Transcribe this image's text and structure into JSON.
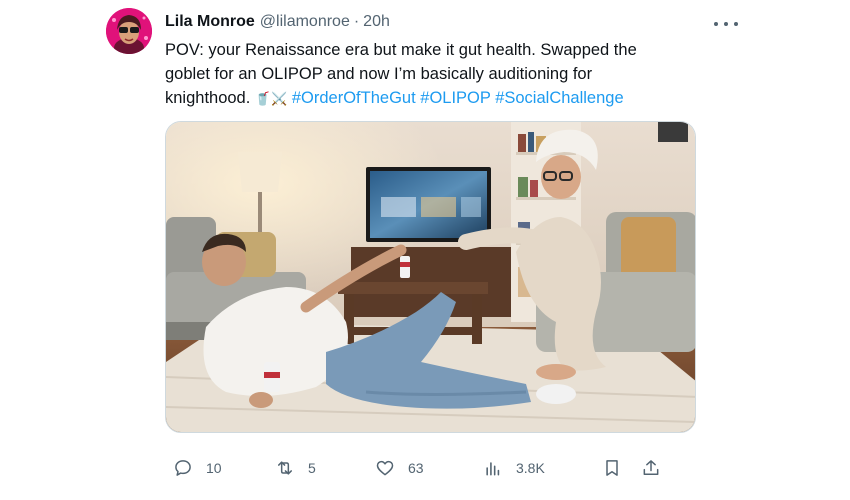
{
  "author": {
    "name": "Lila Monroe",
    "handle": "@lilamonroe",
    "separator": "·",
    "time": "20h"
  },
  "tweet": {
    "text_line1": "POV: your Renaissance era but make it gut health. Swapped the",
    "text_line2": "goblet for an OLIPOP and now I’m basically auditioning for",
    "text_line3_prefix": "knighthood. ",
    "emoji": "🥤⚔️",
    "hashtags": [
      "#OrderOfTheGut",
      "#OLIPOP",
      "#SocialChallenge"
    ]
  },
  "media": {
    "can_label": "OLIPOP",
    "icon": "photo"
  },
  "actions": {
    "reply_count": "10",
    "retweet_count": "5",
    "like_count": "63",
    "views_count": "3.8K"
  },
  "icons": {
    "reply": "reply-icon",
    "retweet": "retweet-icon",
    "like": "heart-icon",
    "views": "views-icon",
    "bookmark": "bookmark-icon",
    "share": "share-icon",
    "more": "more-icon"
  },
  "colors": {
    "link": "#1d9bf0",
    "secondary_text": "#536471",
    "avatar_bg": "#e0127a"
  }
}
